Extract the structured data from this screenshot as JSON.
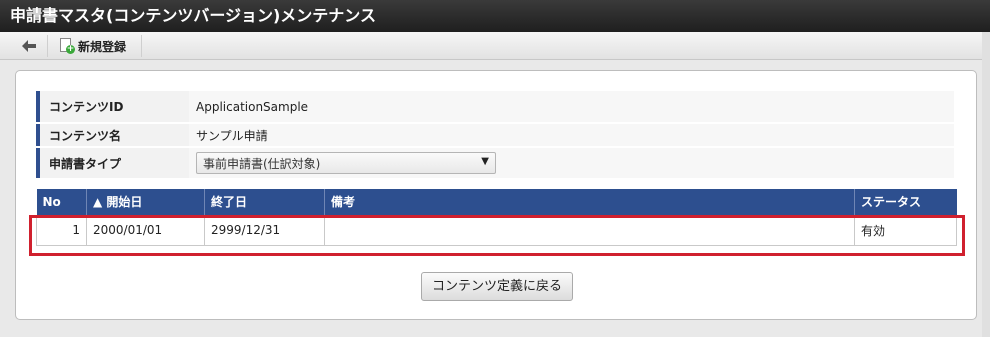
{
  "title": "申請書マスタ(コンテンツバージョン)メンテナンス",
  "toolbar": {
    "new_label": "新規登録"
  },
  "form": {
    "rows": [
      {
        "label": "コンテンツID",
        "value": "ApplicationSample"
      },
      {
        "label": "コンテンツ名",
        "value": "サンプル申請"
      },
      {
        "label": "申請書タイプ",
        "value": "事前申請書(仕訳対象)"
      }
    ]
  },
  "table": {
    "columns": [
      "No",
      "▲ 開始日",
      "終了日",
      "備考",
      "ステータス"
    ],
    "rows": [
      {
        "no": "1",
        "start": "2000/01/01",
        "end": "2999/12/31",
        "note": "",
        "status": "有効"
      }
    ]
  },
  "buttons": {
    "back_to_definition": "コンテンツ定義に戻る"
  },
  "colors": {
    "header_blue": "#2d4f8f",
    "highlight_red": "#d0202e"
  }
}
